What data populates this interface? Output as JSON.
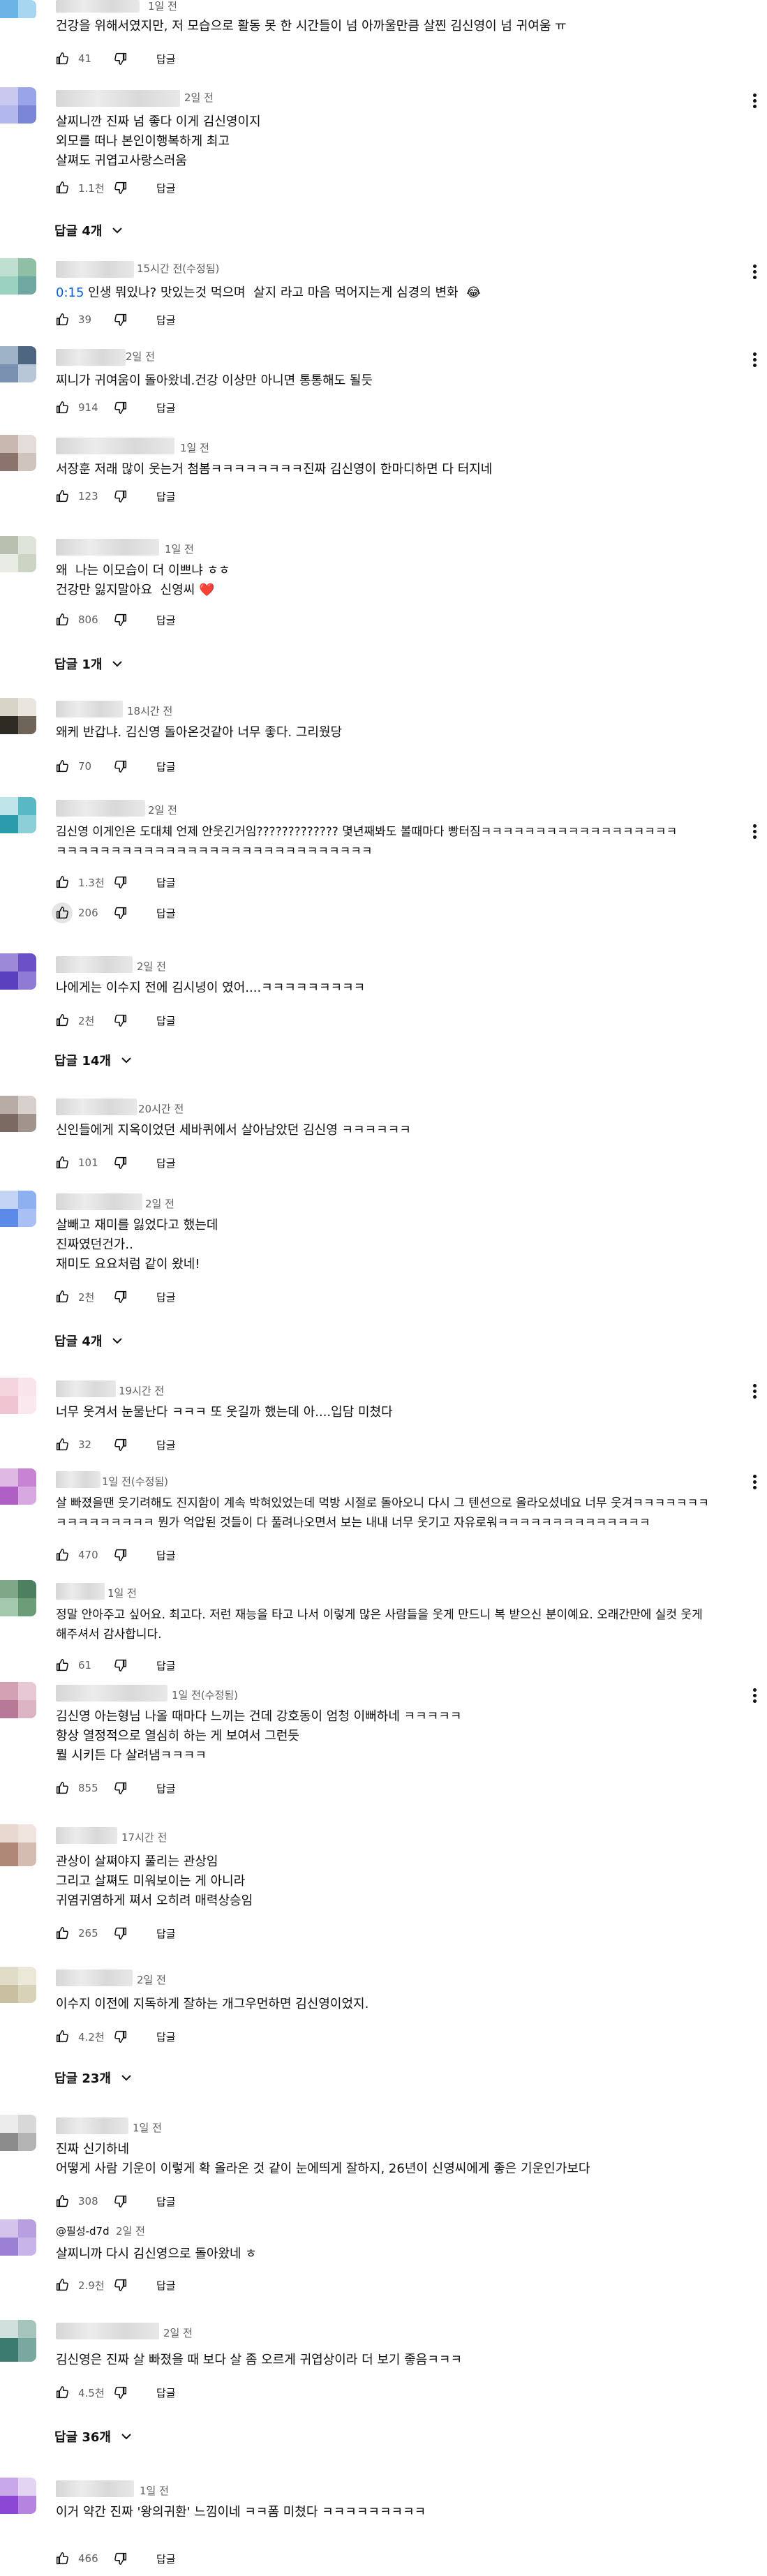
{
  "ui": {
    "reply_label": "답글",
    "like_icon": "thumbs-up-icon",
    "dislike_icon": "thumbs-down-icon",
    "menu_icon": "more-vert-icon",
    "chevron_icon": "chevron-down-icon"
  },
  "comments": [
    {
      "time": "1일 전",
      "lines": [
        "건강을 위해서였지만, 저 모습으로 활동 못 한 시간들이 넘 아까울만큼 살찐 김신영이 넘 귀여움 ㅠ"
      ],
      "likes": "41"
    },
    {
      "time": "2일 전",
      "lines": [
        "살찌니깐 진짜 넘 좋다 이게 김신영이지",
        "외모를 떠나 본인이행복하게 최고",
        "살쪄도 귀엽고사랑스러움"
      ],
      "likes": "1.1천",
      "replies": "답글 4개"
    },
    {
      "time": "15시간 전(수정됨)",
      "timestamp": "0:15",
      "lines": [
        " 인생 뭐있나? 맛있는것 먹으며  살지 라고 마음 먹어지는게 심경의 변화  😂"
      ],
      "likes": "39"
    },
    {
      "time": "2일 전",
      "lines": [
        "찌니가 귀여움이 돌아왔네.건강 이상만 아니면 통통해도 될듯"
      ],
      "likes": "914"
    },
    {
      "time": "1일 전",
      "lines": [
        "서장훈 저래 많이 웃는거 첨봄ㅋㅋㅋㅋㅋㅋㅋㅋ진짜 김신영이 한마디하면 다 터지네"
      ],
      "likes": "123"
    },
    {
      "time": "1일 전",
      "lines": [
        "왜  나는 이모습이 더 이쁘냐 ㅎㅎ",
        "건강만 잃지말아요  신영씨 ❤️"
      ],
      "likes": "806",
      "replies": "답글 1개"
    },
    {
      "time": "18시간 전",
      "lines": [
        "왜케 반갑냐. 김신영 돌아온것같아 너무 좋다. 그리웠당"
      ],
      "likes": "70"
    },
    {
      "time": "2일 전",
      "lines": [
        "김신영 이게인은 도대체 언제 안웃긴거임????????????? 몇년째봐도 볼때마다 빵터짐ㅋㅋㅋㅋㅋㅋㅋㅋㅋㅋㅋㅋㅋㅋㅋㅋㅋㅋ",
        "ㅋㅋㅋㅋㅋㅋㅋㅋㅋㅋㅋㅋㅋㅋㅋㅋㅋㅋㅋㅋㅋㅋㅋㅋㅋㅋㅋㅋㅋ"
      ],
      "likes": "1.3천"
    },
    {
      "time": "",
      "lines": [],
      "likes": "206"
    },
    {
      "time": "2일 전",
      "lines": [
        "나에게는 이수지 전에 김시녕이 였어....ㅋㅋㅋㅋㅋㅋㅋㅋㅋ"
      ],
      "likes": "2천",
      "replies": "답글 14개"
    },
    {
      "time": "20시간 전",
      "lines": [
        "신인들에게 지옥이었던 세바퀴에서 살아남았던 김신영 ㅋㅋㅋㅋㅋㅋ"
      ],
      "likes": "101"
    },
    {
      "time": "2일 전",
      "lines": [
        "살빼고 재미를 잃었다고 했는데",
        "진짜였던건가..",
        "재미도 요요처럼 같이 왔네!"
      ],
      "likes": "2천",
      "replies": "답글 4개"
    },
    {
      "time": "19시간 전",
      "lines": [
        "너무 웃겨서 눈물난다 ㅋㅋㅋ 또 웃길까 했는데 아....입담 미쳤다"
      ],
      "likes": "32"
    },
    {
      "time": "1일 전(수정됨)",
      "lines": [
        "살 빠졌을땐 웃기려해도 진지함이 계속 박혀있었는데 먹방 시절로 돌아오니 다시 그 텐션으로 올라오셨네요 너무 웃겨ㅋㅋㅋㅋㅋㅋㅋ",
        "ㅋㅋㅋㅋㅋㅋㅋㅋㅋ 뭔가 억압된 것들이 다 풀려나오면서 보는 내내 너무 웃기고 자유로워ㅋㅋㅋㅋㅋㅋㅋㅋㅋㅋㅋㅋㅋㅋ"
      ],
      "likes": "470"
    },
    {
      "time": "1일 전",
      "lines": [
        "정말 안아주고 싶어요. 최고다. 저런 재능을 타고 나서 이렇게 많은 사람들을 웃게 만드니 복 받으신 분이예요. 오래간만에 실컷 웃게",
        "해주셔서 감사합니다."
      ],
      "likes": "61"
    },
    {
      "time": "1일 전(수정됨)",
      "lines": [
        "김신영 아는형님 나올 때마다 느끼는 건데 강호동이 엄청 이뻐하네 ㅋㅋㅋㅋㅋ",
        "항상 열정적으로 열심히 하는 게 보여서 그런듯",
        "뭘 시키든 다 살려냄ㅋㅋㅋㅋ"
      ],
      "likes": "855"
    },
    {
      "time": "17시간 전",
      "lines": [
        "관상이 살쪄야지 풀리는 관상임",
        "그리고 살쪄도 미워보이는 게 아니라",
        "귀염귀염하게 쪄서 오히려 매력상승임"
      ],
      "likes": "265"
    },
    {
      "time": "2일 전",
      "lines": [
        "이수지 이전에 지독하게 잘하는 개그우먼하면 김신영이었지."
      ],
      "likes": "4.2천",
      "replies": "답글 23개"
    },
    {
      "time": "1일 전",
      "lines": [
        "진짜 신기하네",
        "어떻게 사람 기운이 이렇게 확 올라온 것 같이 눈에띄게 잘하지, 26년이 신영씨에게 좋은 기운인가보다"
      ],
      "likes": "308"
    },
    {
      "handle": "@필성-d7d",
      "time": "2일 전",
      "lines": [
        "살찌니까 다시 김신영으로 돌아왔네 ㅎ"
      ],
      "likes": "2.9천"
    },
    {
      "time": "2일 전",
      "lines": [
        "김신영은 진짜 살 빠졌을 때 보다 살 좀 오르게 귀엽상이라 더 보기 좋음ㅋㅋㅋ"
      ],
      "likes": "4.5천",
      "replies": "답글 36개"
    },
    {
      "time": "1일 전",
      "lines": [
        "이거 약간 진짜 '왕의귀환' 느낌이네 ㅋㅋ폼 미쳤다 ㅋㅋㅋㅋㅋㅋㅋㅋㅋ"
      ],
      "likes": "466"
    }
  ]
}
